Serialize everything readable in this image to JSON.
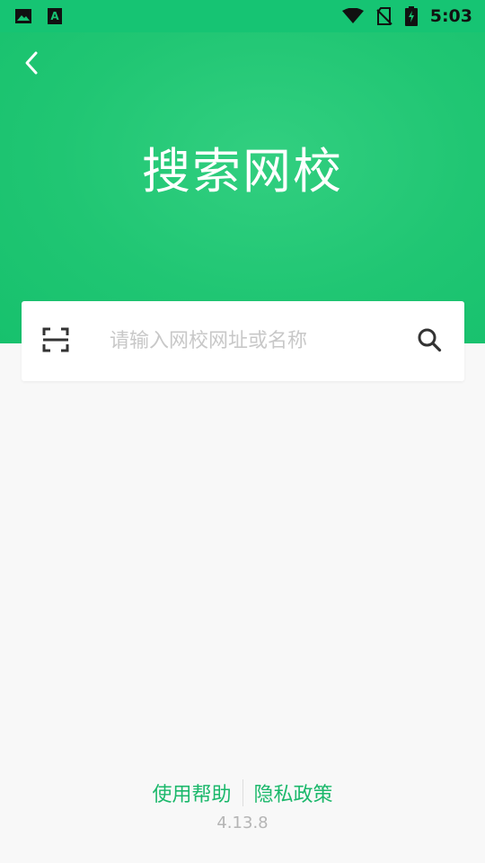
{
  "status_bar": {
    "time": "5:03",
    "left_icons": [
      "image-icon",
      "font-app-icon"
    ],
    "right_icons": [
      "wifi-icon",
      "no-sim-icon",
      "battery-charging-icon"
    ]
  },
  "header": {
    "title": "搜索网校",
    "back_icon": "chevron-left-icon",
    "background_color": "#1fc572"
  },
  "search": {
    "placeholder": "请输入网校网址或名称",
    "value": "",
    "scan_icon": "scan-icon",
    "search_icon": "search-icon"
  },
  "footer": {
    "help_label": "使用帮助",
    "privacy_label": "隐私政策",
    "version": "4.13.8",
    "link_color": "#1bb86b"
  }
}
